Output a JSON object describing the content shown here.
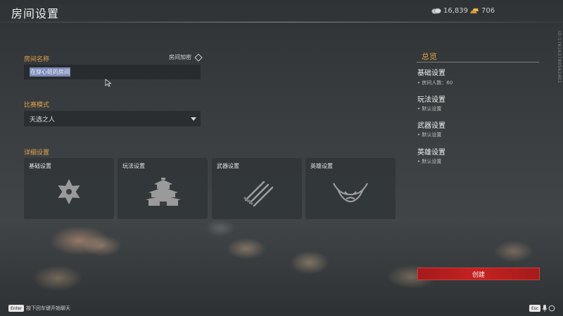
{
  "header": {
    "title": "房间设置",
    "silver_icon": "silver-coins-icon",
    "silver_amount": "16,839",
    "gold_icon": "gold-bars-icon",
    "gold_amount": "706"
  },
  "player_uid": "ID:176163780562401",
  "room": {
    "name_label": "房间名称",
    "name_value": "在穿心蛀的房间",
    "encrypt_label": "房间加密"
  },
  "mode": {
    "label": "比赛模式",
    "selected": "天选之人"
  },
  "details": {
    "label": "详细设置",
    "cards": [
      {
        "label": "基础设置",
        "icon": "flower-crest-icon"
      },
      {
        "label": "玩法设置",
        "icon": "pagoda-icon"
      },
      {
        "label": "武器设置",
        "icon": "crossed-swords-icon"
      },
      {
        "label": "英雄设置",
        "icon": "demon-mask-icon"
      }
    ]
  },
  "summary": {
    "title": "总览",
    "sections": [
      {
        "heading": "基础设置",
        "detail": "• 房间人数：60"
      },
      {
        "heading": "玩法设置",
        "detail": "• 默认设置"
      },
      {
        "heading": "武器设置",
        "detail": "• 默认设置"
      },
      {
        "heading": "英雄设置",
        "detail": "• 默认设置"
      }
    ]
  },
  "create_label": "创建",
  "footer": {
    "enter_key": "Enter",
    "enter_hint": "按下回车键开始聊天",
    "esc_key": "Esc"
  },
  "colors": {
    "accent": "#e3a24a",
    "create": "#c62222"
  }
}
